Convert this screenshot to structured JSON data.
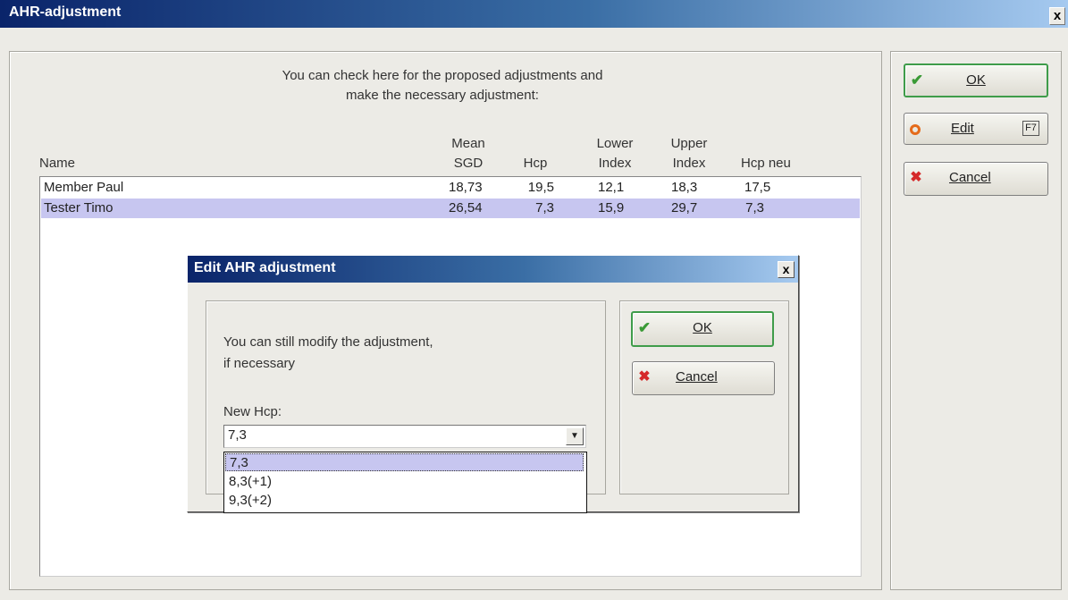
{
  "window": {
    "title": "AHR-adjustment",
    "close_label": "x"
  },
  "intro": {
    "line1": "You can check here for the proposed adjustments and",
    "line2": "make the necessary adjustment:"
  },
  "table": {
    "headers": {
      "name": "Name",
      "mean_top": "Mean",
      "mean_bottom": "SGD",
      "hcp": "Hcp",
      "lower_top": "Lower",
      "lower_bottom": "Index",
      "upper_top": "Upper",
      "upper_bottom": "Index",
      "hcp_neu": "Hcp neu"
    },
    "rows": [
      {
        "name": "Member Paul",
        "sgd": "18,73",
        "hcp": "19,5",
        "lower": "12,1",
        "upper": "18,3",
        "hcp_neu": "17,5",
        "selected": false
      },
      {
        "name": "Tester Timo",
        "sgd": "26,54",
        "hcp": "7,3",
        "lower": "15,9",
        "upper": "29,7",
        "hcp_neu": "7,3",
        "selected": true
      }
    ]
  },
  "buttons": {
    "ok": {
      "label": "OK",
      "icon": "checkmark-icon"
    },
    "edit": {
      "label": "Edit",
      "shortcut": "F7",
      "icon": "circle-icon"
    },
    "cancel": {
      "label": "Cancel",
      "icon": "x-icon"
    }
  },
  "dialog": {
    "title": "Edit AHR adjustment",
    "close_label": "x",
    "message_line1": "You can still modify the adjustment,",
    "message_line2": "if necessary",
    "new_hcp_label": "New Hcp:",
    "combo_value": "7,3",
    "options": [
      "7,3",
      "8,3(+1)",
      "9,3(+2)"
    ],
    "ok_label": "OK",
    "cancel_label": "Cancel"
  },
  "colors": {
    "title_gradient_start": "#0a246a",
    "selection": "#c7c6f0",
    "ok_border": "#3f9c4a",
    "cancel_x": "#d52929",
    "edit_circle": "#e56b1a"
  }
}
